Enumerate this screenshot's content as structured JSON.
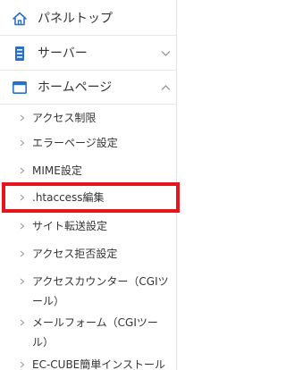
{
  "nav": {
    "items": [
      {
        "label": "パネルトップ",
        "icon": "home-icon"
      },
      {
        "label": "サーバー",
        "icon": "server-icon",
        "expanded": false
      },
      {
        "label": "ホームページ",
        "icon": "window-icon",
        "expanded": true
      }
    ],
    "homepage_submenu": [
      "アクセス制限",
      "エラーページ設定",
      "MIME設定",
      ".htaccess編集",
      "サイト転送設定",
      "アクセス拒否設定",
      "アクセスカウンター（CGIツール）",
      "メールフォーム（CGIツール）",
      "EC-CUBE簡単インストール"
    ],
    "highlighted_item": ".htaccess編集"
  },
  "colors": {
    "accent_blue": "#2a6fc9",
    "highlight_red": "#e8141b",
    "divider": "#e6e6e6",
    "icon_gray": "#999999"
  }
}
